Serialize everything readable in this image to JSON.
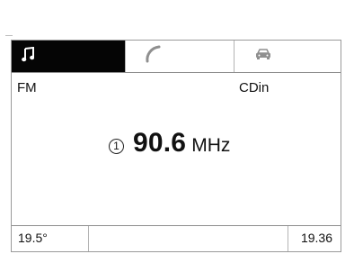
{
  "tabs": [
    {
      "id": "audio",
      "icon": "music-note-icon",
      "selected": true
    },
    {
      "id": "phone",
      "icon": "phone-handset-icon",
      "selected": false
    },
    {
      "id": "navigation",
      "icon": "car-icon",
      "selected": false
    }
  ],
  "source": {
    "left": "FM",
    "right": "CDin"
  },
  "radio": {
    "preset": "1",
    "frequency": "90.6",
    "unit": "MHz"
  },
  "status": {
    "temperature": "19.5°",
    "time": "19.36"
  },
  "colors": {
    "selected_tab_bg": "#050505",
    "selected_tab_icon": "#ffffff",
    "inactive_icon": "#9a9a9a",
    "text": "#111111"
  }
}
